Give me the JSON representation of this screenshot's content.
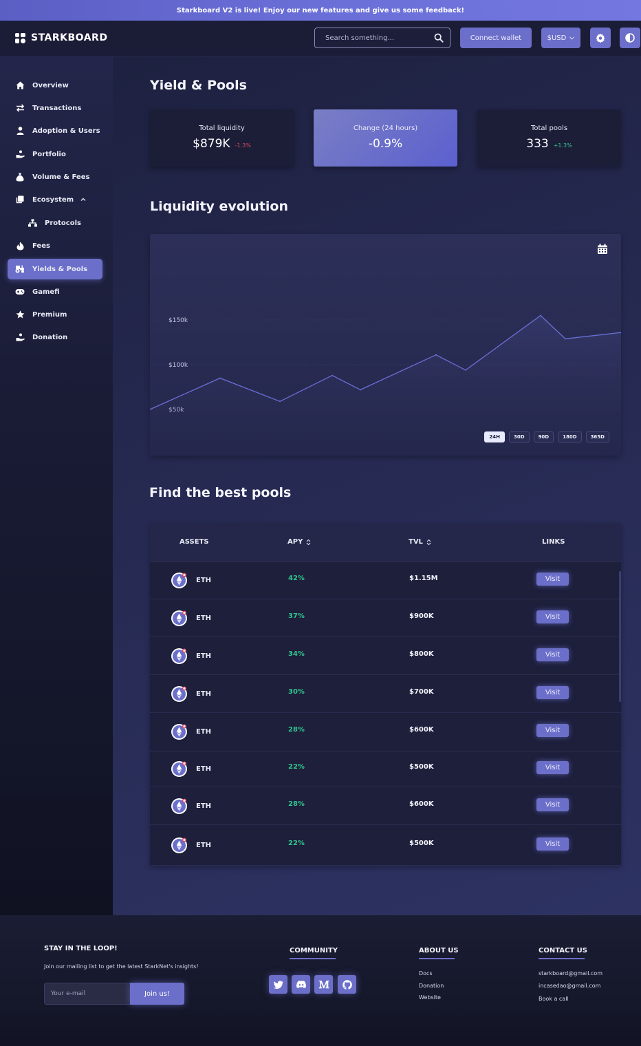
{
  "banner": {
    "text": "Starkboard V2 is live! Enjoy our new features and give us some feedback!"
  },
  "header": {
    "logo_text": "STARKBOARD",
    "search_placeholder": "Search something...",
    "connect_label": "Connect wallet",
    "currency_label": "$USD"
  },
  "sidebar": {
    "items": [
      {
        "label": "Overview",
        "icon": "home-icon"
      },
      {
        "label": "Transactions",
        "icon": "arrows-icon"
      },
      {
        "label": "Adoption & Users",
        "icon": "user-icon"
      },
      {
        "label": "Portfolio",
        "icon": "hand-coin-icon"
      },
      {
        "label": "Volume & Fees",
        "icon": "money-bag-icon"
      },
      {
        "label": "Ecosystem",
        "icon": "layers-icon"
      },
      {
        "label": "Protocols",
        "icon": "sitemap-icon"
      },
      {
        "label": "Fees",
        "icon": "flame-icon"
      },
      {
        "label": "Yields & Pools",
        "icon": "tractor-icon"
      },
      {
        "label": "Gamefi",
        "icon": "gamepad-icon"
      },
      {
        "label": "Premium",
        "icon": "star-icon"
      },
      {
        "label": "Donation",
        "icon": "hand-coin-icon"
      }
    ]
  },
  "page": {
    "title": "Yield & Pools",
    "stats": [
      {
        "label": "Total liquidity",
        "value": "$879K",
        "change": "-1.3%",
        "change_color": "#e0435c"
      },
      {
        "label": "Change (24 hours)",
        "value": "-0.9%",
        "change": "",
        "change_color": ""
      },
      {
        "label": "Total pools",
        "value": "333",
        "change": "+1.3%",
        "change_color": "#31c48d"
      }
    ],
    "chart_title": "Liquidity evolution",
    "ranges": [
      "24H",
      "30D",
      "90D",
      "180D",
      "365D"
    ],
    "selected_range": "24H",
    "pools_title": "Find the best pools",
    "table": {
      "headers": [
        "ASSETS",
        "APY",
        "TVL",
        "LINKS"
      ],
      "rows": [
        {
          "asset": "ETH",
          "apy": "42%",
          "tvl": "$1.15M",
          "link": "Visit"
        },
        {
          "asset": "ETH",
          "apy": "37%",
          "tvl": "$900K",
          "link": "Visit"
        },
        {
          "asset": "ETH",
          "apy": "34%",
          "tvl": "$800K",
          "link": "Visit"
        },
        {
          "asset": "ETH",
          "apy": "30%",
          "tvl": "$700K",
          "link": "Visit"
        },
        {
          "asset": "ETH",
          "apy": "28%",
          "tvl": "$600K",
          "link": "Visit"
        },
        {
          "asset": "ETH",
          "apy": "22%",
          "tvl": "$500K",
          "link": "Visit"
        },
        {
          "asset": "ETH",
          "apy": "28%",
          "tvl": "$600K",
          "link": "Visit"
        },
        {
          "asset": "ETH",
          "apy": "22%",
          "tvl": "$500K",
          "link": "Visit"
        }
      ]
    }
  },
  "chart_data": {
    "type": "area",
    "title": "",
    "xlabel": "",
    "ylabel": "",
    "y_ticks": [
      "$50k",
      "$100k",
      "$150k"
    ],
    "ylim": [
      50000,
      150000
    ],
    "x": [
      0,
      1,
      2,
      3,
      4,
      5,
      6,
      7,
      8,
      9,
      10,
      11
    ],
    "series": [
      {
        "values": [
          50000,
          85000,
          59000,
          88000,
          72000,
          111000,
          94000,
          155000,
          129000,
          136000
        ]
      }
    ],
    "line_color": "#6a6fd6",
    "grid": true
  },
  "footer": {
    "newsletter_title": "STAY IN THE LOOP!",
    "newsletter_text": "Join our mailing list to get the latest StarkNet's insights!",
    "email_placeholder": "Your e-mail",
    "join_label": "Join us!",
    "community_title": "COMMUNITY",
    "social": [
      "twitter-icon",
      "discord-icon",
      "medium-icon",
      "github-icon"
    ],
    "about_title": "ABOUT US",
    "about_links": [
      "Docs",
      "Donation",
      "Website"
    ],
    "contact_title": "CONTACT US",
    "contact_links": [
      "starkboard@gmail.com",
      "incasedao@gmail.com",
      "Book a call"
    ]
  },
  "colors": {
    "accent": "#6b6fc9",
    "positive": "#31c48d",
    "negative": "#e0435c"
  }
}
